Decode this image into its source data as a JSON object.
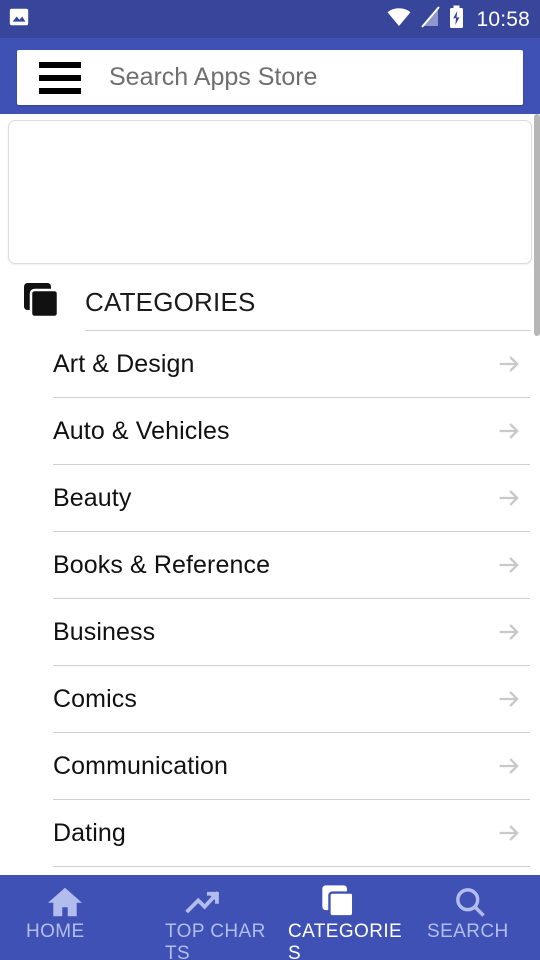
{
  "status_bar": {
    "notification_icon": "image-icon",
    "wifi_icon": "wifi-icon",
    "signal_off_icon": "signal-off-icon",
    "battery_icon": "battery-charging-icon",
    "time": "10:58",
    "background_color": "#37459b"
  },
  "app_bar": {
    "menu_icon": "hamburger-menu-icon",
    "search_placeholder": "Search Apps Store",
    "search_value": "",
    "background_color": "#4051b5"
  },
  "banner": {
    "content": ""
  },
  "section": {
    "icon": "layers-icon",
    "title": "CATEGORIES"
  },
  "categories": [
    {
      "label": "Art & Design",
      "arrow_icon": "arrow-right-icon"
    },
    {
      "label": "Auto & Vehicles",
      "arrow_icon": "arrow-right-icon"
    },
    {
      "label": "Beauty",
      "arrow_icon": "arrow-right-icon"
    },
    {
      "label": "Books & Reference",
      "arrow_icon": "arrow-right-icon"
    },
    {
      "label": "Business",
      "arrow_icon": "arrow-right-icon"
    },
    {
      "label": "Comics",
      "arrow_icon": "arrow-right-icon"
    },
    {
      "label": "Communication",
      "arrow_icon": "arrow-right-icon"
    },
    {
      "label": "Dating",
      "arrow_icon": "arrow-right-icon"
    }
  ],
  "bottom_nav": {
    "active_color": "#ffffff",
    "inactive_color": "#b3bded",
    "background_color": "#4051b5",
    "items": [
      {
        "label": "HOME",
        "icon": "home-icon",
        "active": false
      },
      {
        "label": "TOP CHARTS",
        "icon": "trending-up-icon",
        "active": false
      },
      {
        "label": "CATEGORIES",
        "icon": "layers-icon",
        "active": true
      },
      {
        "label": "SEARCH",
        "icon": "search-icon",
        "active": false
      }
    ]
  }
}
